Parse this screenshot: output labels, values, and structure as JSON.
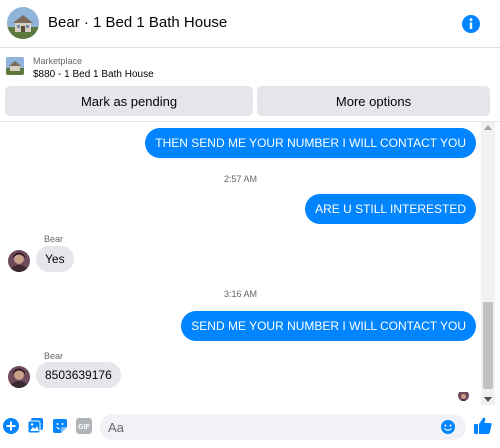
{
  "header": {
    "title": "Bear · 1 Bed 1 Bath House",
    "info_icon": "info-icon"
  },
  "listing": {
    "kind": "Marketplace",
    "price_title": "$880 - 1 Bed 1 Bath House",
    "buttons": {
      "pending": "Mark as pending",
      "more": "More options"
    }
  },
  "thread": {
    "messages": [
      {
        "type": "outgoing",
        "text": "THEN SEND ME YOUR NUMBER I WILL CONTACT YOU"
      },
      {
        "type": "timestamp",
        "text": "2:57 AM"
      },
      {
        "type": "outgoing",
        "text": "ARE U STILL INTERESTED"
      },
      {
        "type": "sender",
        "text": "Bear"
      },
      {
        "type": "incoming",
        "text": "Yes"
      },
      {
        "type": "timestamp",
        "text": "3:16 AM"
      },
      {
        "type": "outgoing",
        "text": "SEND ME YOUR NUMBER I WILL CONTACT YOU"
      },
      {
        "type": "sender",
        "text": "Bear"
      },
      {
        "type": "incoming",
        "text": "8503639176"
      }
    ]
  },
  "composer": {
    "placeholder": "Aa",
    "icons": [
      "plus-icon",
      "photo-icon",
      "sticker-icon",
      "gif-icon",
      "emoji-icon",
      "like-icon"
    ],
    "gif_label": "GIF"
  },
  "colors": {
    "accent": "#0084ff",
    "bubble_in": "#e4e6eb",
    "button_bg": "#e4e6eb"
  }
}
